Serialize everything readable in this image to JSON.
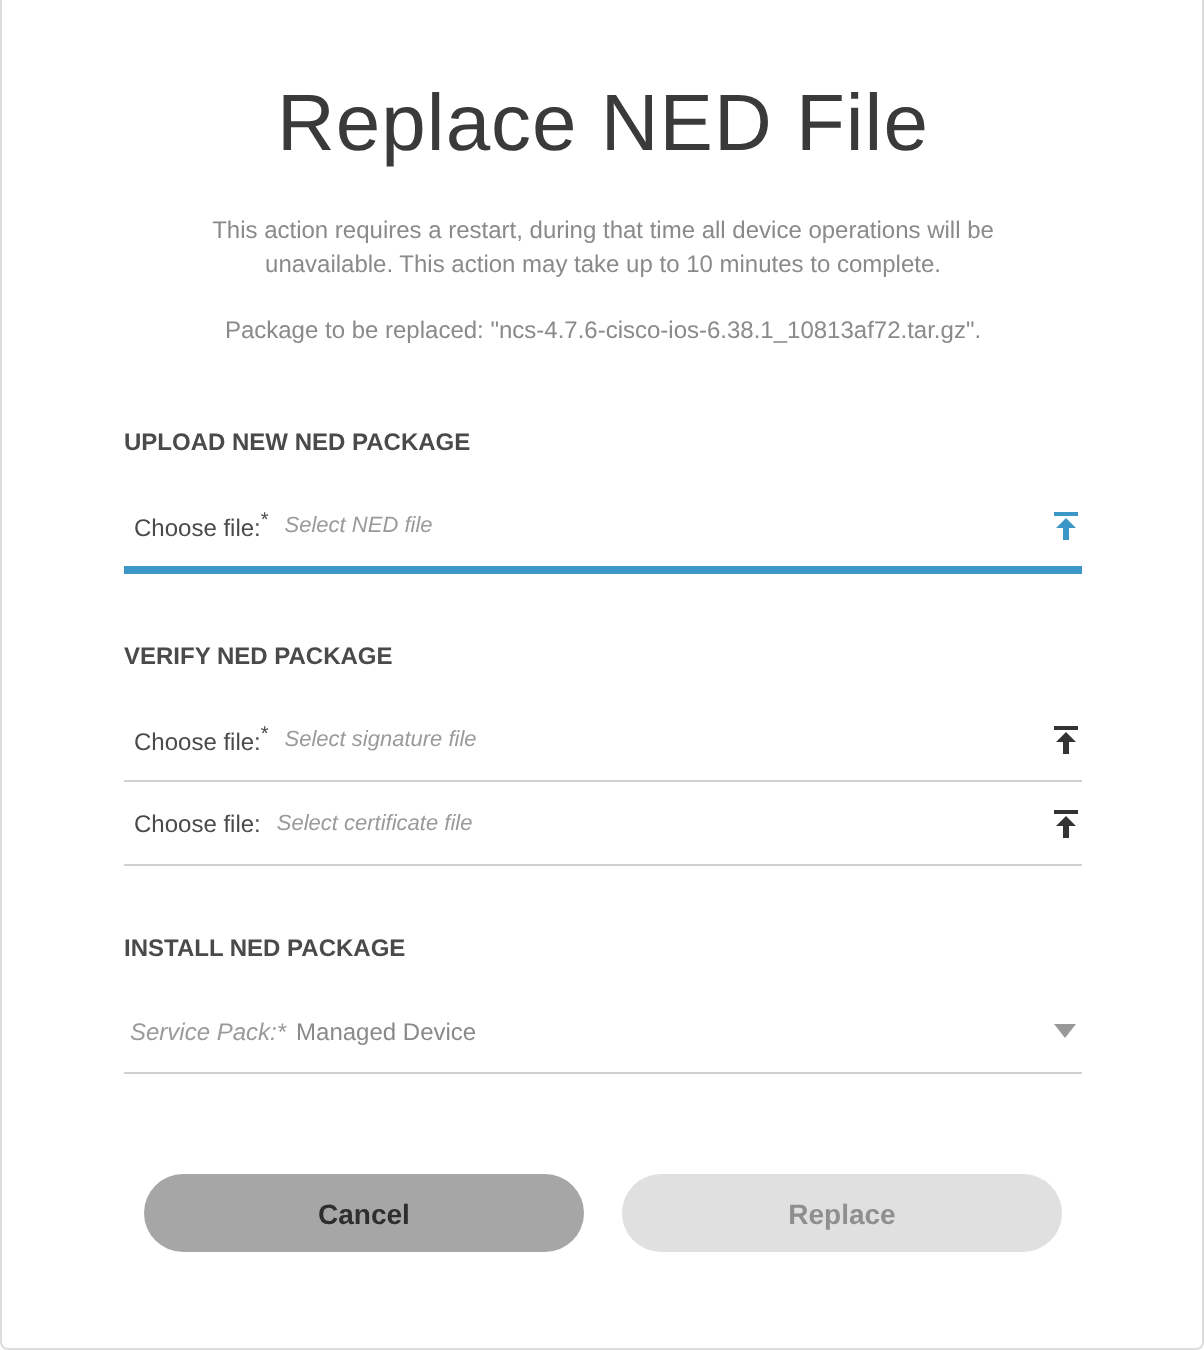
{
  "dialog": {
    "title": "Replace NED File",
    "message": "This action requires a restart, during that time all device operations will be unavailable. This action may take up to 10 minutes to complete.",
    "package_note": "Package to be replaced: \"ncs-4.7.6-cisco-ios-6.38.1_10813af72.tar.gz\".",
    "sections": [
      {
        "heading": "UPLOAD NEW NED PACKAGE",
        "fields": [
          {
            "kind": "file",
            "label": "Choose file:$^{*}$",
            "placeholder": "Select NED file",
            "focused": true
          }
        ]
      },
      {
        "heading": "VERIFY NED PACKAGE",
        "fields": [
          {
            "kind": "file",
            "label": "Choose file:$^{*}$",
            "placeholder": "Select signature file",
            "focused": false
          },
          {
            "kind": "file",
            "label": "Choose file:",
            "placeholder": "Select certificate file",
            "focused": false
          }
        ]
      },
      {
        "heading": "INSTALL NED PACKAGE",
        "fields": [
          {
            "kind": "select",
            "label": "Service Pack:*",
            "value": "Managed Device",
            "focused": false
          }
        ]
      }
    ],
    "buttons": [
      {
        "label": "Cancel",
        "disabled": false
      },
      {
        "label": "Replace",
        "disabled": true
      }
    ]
  }
}
